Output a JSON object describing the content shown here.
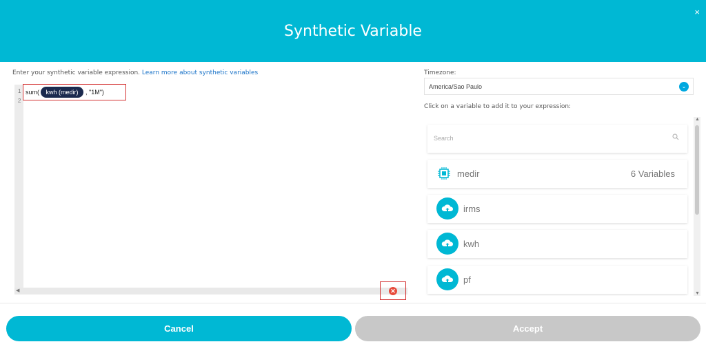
{
  "dialog": {
    "title": "Synthetic Variable",
    "close": "×"
  },
  "intro": {
    "text": "Enter your synthetic variable expression. ",
    "link": "Learn more about synthetic variables"
  },
  "editor": {
    "line_numbers": [
      "1",
      "2"
    ],
    "expression": {
      "func": "sum(",
      "variable_pill": "kwh (medir)",
      "args": ", \"1M\")"
    },
    "scroll_left": "◀",
    "error_icon": "error-icon"
  },
  "timezone": {
    "label": "Timezone:",
    "value": "America/Sao Paulo",
    "chevron": "⌄"
  },
  "hint": "Click on a variable to add it to your expression:",
  "search": {
    "placeholder": "Search"
  },
  "device": {
    "name": "medir",
    "count": "6 Variables",
    "icon": "chip-icon"
  },
  "variables": [
    {
      "name": "irms",
      "icon": "cloud-upload-icon"
    },
    {
      "name": "kwh",
      "icon": "cloud-upload-icon"
    },
    {
      "name": "pf",
      "icon": "cloud-upload-icon"
    }
  ],
  "buttons": {
    "cancel": "Cancel",
    "accept": "Accept"
  },
  "colors": {
    "accent": "#00b8d4",
    "pill": "#1b2a4e",
    "error": "#d32f2f",
    "disabled": "#c8c8c8"
  }
}
